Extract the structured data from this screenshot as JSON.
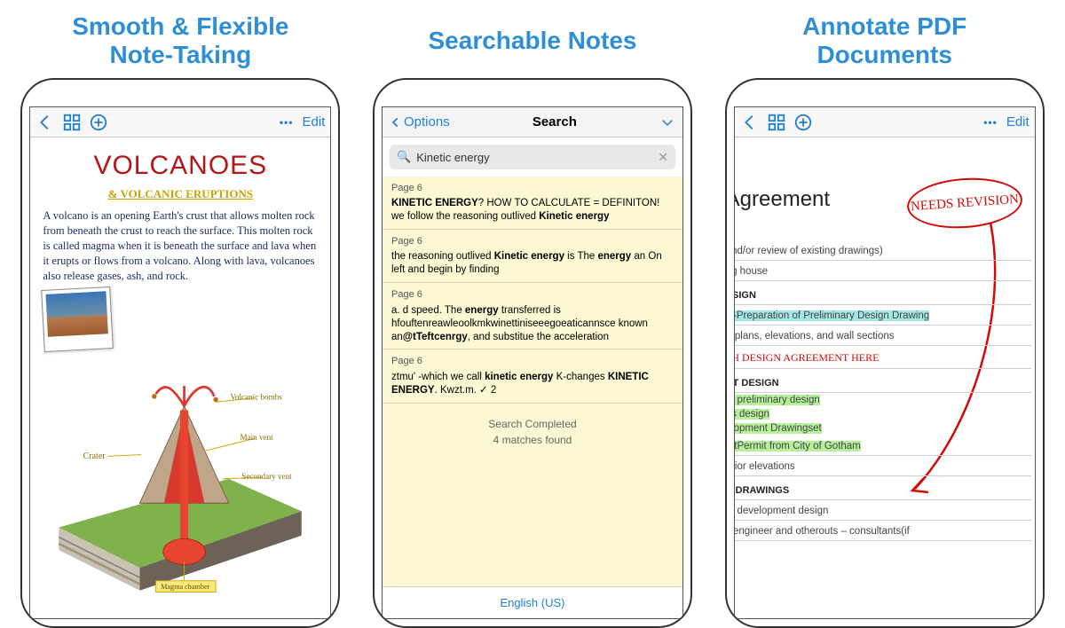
{
  "columns": {
    "c1": {
      "headline": "Smooth & Flexible\nNote-Taking"
    },
    "c2": {
      "headline": "Searchable Notes"
    },
    "c3": {
      "headline": "Annotate PDF\nDocuments"
    }
  },
  "nav": {
    "edit_label": "Edit",
    "more_dots": "•••"
  },
  "phone1": {
    "title": "VOLCANOES",
    "subtitle": "& VOLCANIC ERUPTIONS",
    "paragraph": "A volcano is an opening Earth's crust that allows molten rock from beneath the crust to reach the surface. This molten rock is called magma when it is beneath the surface and lava when it erupts or flows from a volcano. Along with lava, volcanoes also release gases, ash, and rock.",
    "labels": {
      "crater": "Crater",
      "volcanic_bombs": "Volcanic bombs",
      "main_vent": "Main vent",
      "secondary_vent": "Secondary vent",
      "magma_chamber": "Magma chamber"
    }
  },
  "phone2": {
    "back_label": "Options",
    "title": "Search",
    "query": "Kinetic energy",
    "results": [
      {
        "page": "Page 6",
        "html": "<b>KINETIC ENERGY</b>? HOW TO CALCULATE = DEFINITON! we follow the reasoning outlived <b>Kinetic energy</b>"
      },
      {
        "page": "Page 6",
        "html": "the reasoning outlived <b>Kinetic energy</b> is The <b>energy</b> an On left and begin by finding"
      },
      {
        "page": "Page 6",
        "html": "a. d speed. The <b>energy</b> transferred is hfouftenreawleoolkmkwinettiniseeegoeaticannsce known an<b>@tTeftcenrgy</b>, and substitue the acceleration"
      },
      {
        "page": "Page 6",
        "html": "ztmu' -which we call <b>kinetic energy</b> K-changes <b>KINETIC ENERGY</b>. Kwzt.m. ✓ 2"
      }
    ],
    "completed": "Search Completed",
    "matches": "4 matches found",
    "language": "English (US)"
  },
  "phone3": {
    "doc_title": "Agreement",
    "revision_note": "NEEDS REVISION",
    "lines": {
      "l1": "and/or review of existing drawings)",
      "l2": "ng house",
      "sec1": "ESIGN",
      "l3_hl": "s–Preparation of Preliminary Design Drawing",
      "l4": "orplans, elevations, and wall sections",
      "l5_red": "PH  DESIGN  AGREEMENT  HERE",
      "sec2": "NT DESIGN",
      "g1": "of preliminary design",
      "g2": "es design",
      "g3": "elopment Drawingset",
      "g4": "o tPermit from City of Gotham",
      "l6": "erior elevations",
      "sec3": "N DRAWINGS",
      "l7": "of development design",
      "l8": "il engineer and otherouts – consultants(if"
    }
  }
}
